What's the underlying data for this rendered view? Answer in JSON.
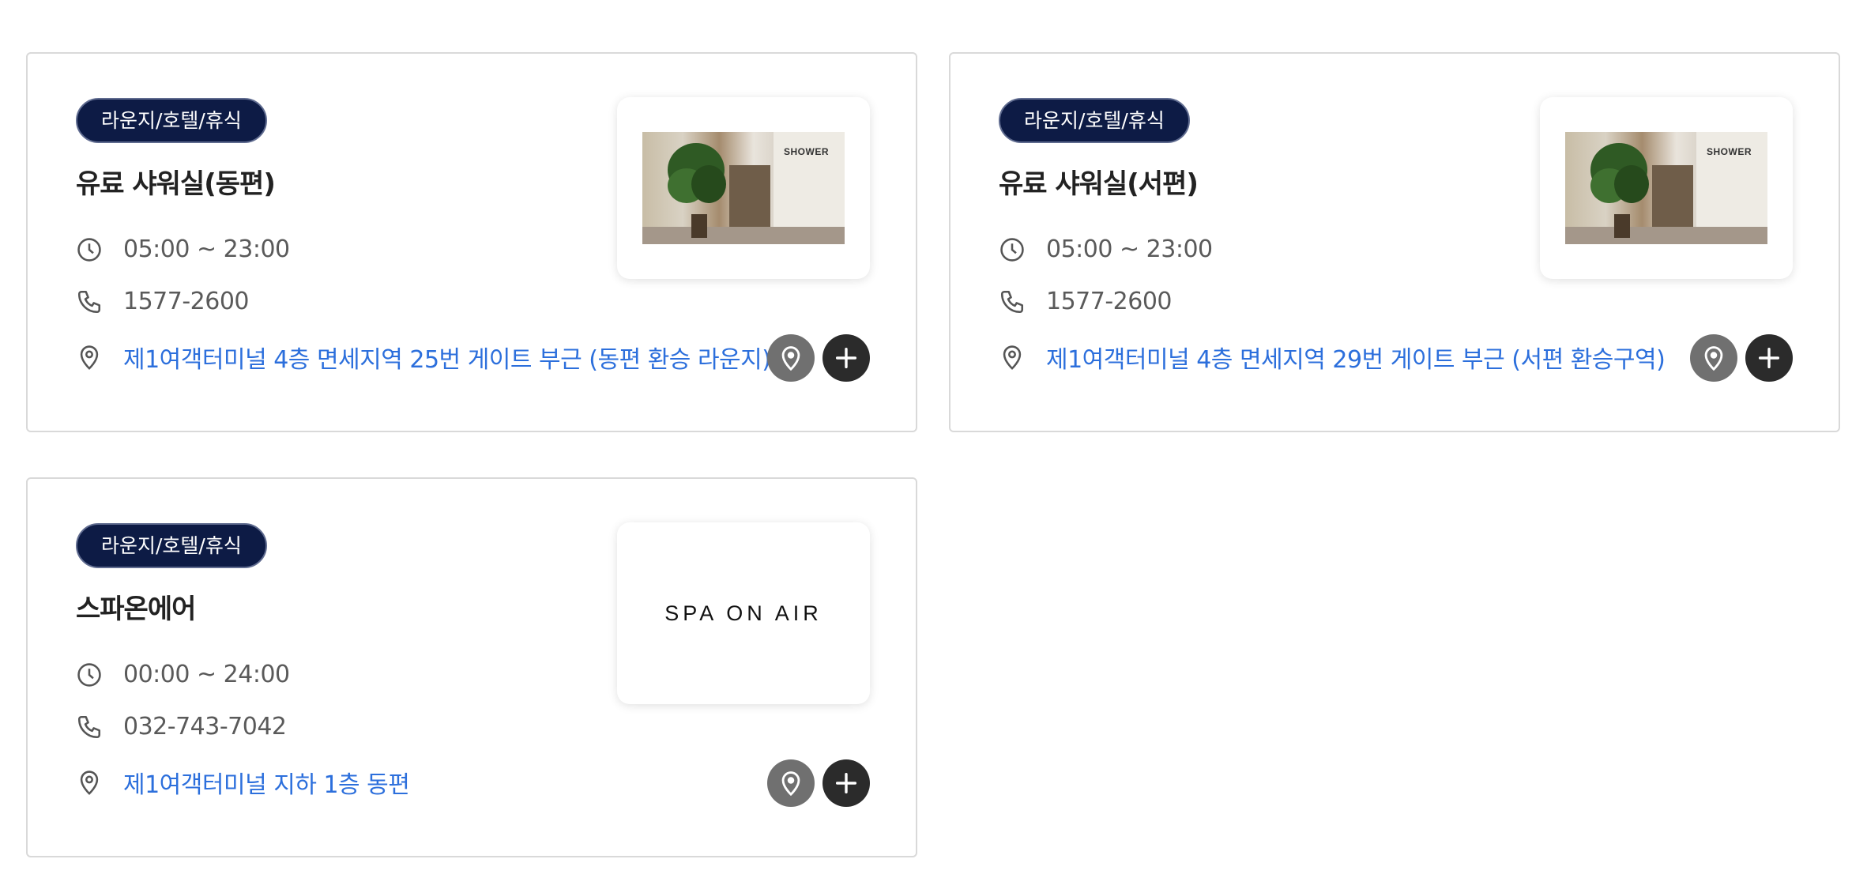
{
  "cards": [
    {
      "category": "라운지/호텔/휴식",
      "title": "유료 샤워실(동편)",
      "hours": "05:00 ~ 23:00",
      "phone": "1577-2600",
      "address": "제1여객터미널 4층 면세지역 25번 게이트 부근 (동편 환승 라운지)",
      "image": {
        "type": "photo",
        "sign_text": "SHOWER"
      }
    },
    {
      "category": "라운지/호텔/휴식",
      "title": "유료 샤워실(서편)",
      "hours": "05:00 ~ 23:00",
      "phone": "1577-2600",
      "address": "제1여객터미널 4층 면세지역 29번 게이트 부근 (서편 환승구역)",
      "image": {
        "type": "photo",
        "sign_text": "SHOWER"
      }
    },
    {
      "category": "라운지/호텔/휴식",
      "title": "스파온에어",
      "hours": "00:00 ~ 24:00",
      "phone": "032-743-7042",
      "address": "제1여객터미널 지하 1층 동편",
      "image": {
        "type": "logo",
        "logo_text": "SPA ON AIR"
      }
    }
  ],
  "icons": {
    "hours": "clock-icon",
    "phone": "phone-icon",
    "address": "location-pin-icon",
    "map_button": "map-pin-icon",
    "add_button": "plus-icon"
  },
  "colors": {
    "badge_bg": "#0d1b45",
    "address_link": "#2c6fdc",
    "map_button_bg": "#707070",
    "add_button_bg": "#2b2b2b"
  }
}
